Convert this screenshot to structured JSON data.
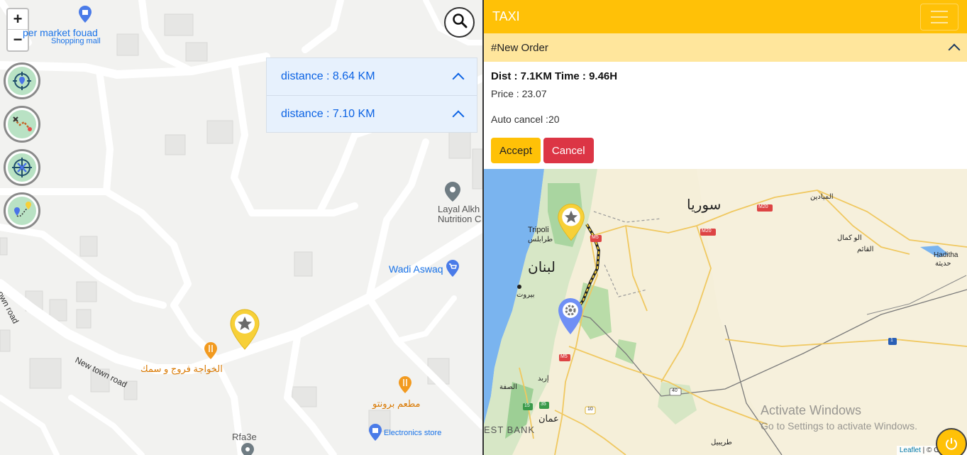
{
  "left_map": {
    "zoom_in": "+",
    "zoom_out": "−",
    "distances": [
      {
        "label": "distance : 8.64 KM"
      },
      {
        "label": "distance : 7.10 KM"
      }
    ],
    "pois": {
      "supermarket": "per market fouad",
      "supermarket_sub": "Shopping mall",
      "layal_1": "Layal Alkh",
      "layal_2": "Nutrition C",
      "wadi": "Wadi Aswaq",
      "khawaja": "الخواجة فروج و سمك",
      "brontu": "مطعم برونتو",
      "electronics": "Electronics store",
      "rfa3e": "Rfa3e"
    },
    "roads": {
      "town_road": "own road",
      "new_town_road": "New town road"
    },
    "icons": [
      "locate-icon",
      "route-icon",
      "target-icon",
      "path-icon",
      "search-icon"
    ]
  },
  "navbar": {
    "brand": "TAXI"
  },
  "order": {
    "header": "#New Order",
    "dist_time": "Dist : 7.1KM Time : 9.46H",
    "price": "Price : 23.07",
    "auto_cancel": "Auto cancel :20",
    "accept": "Accept",
    "cancel": "Cancel"
  },
  "right_map": {
    "labels": {
      "syria": "سوريا",
      "lebanon": "لبنان",
      "tripoli": "Tripoli",
      "tripoli_ar": "طرابلس",
      "beirut_ar": "بيروت",
      "amman_ar": "عمان",
      "irbid_ar": "إربد",
      "west_bank": "EST BANK",
      "tanf": "الو كمال",
      "qaim": "القائم",
      "mayadin": "الميادين",
      "haditha": "Haditha",
      "haditha_ar": "حديثة",
      "safa": "الصفة",
      "trabil": "طريبيل"
    },
    "road_signs": [
      "M20",
      "M20",
      "M5",
      "M5",
      "1",
      "40",
      "15",
      "35",
      "10"
    ],
    "watermark_title": "Activate Windows",
    "watermark_sub": "Go to Settings to activate Windows.",
    "attribution_leaflet": "Leaflet",
    "attribution_rest": "| © OpenStre"
  },
  "colors": {
    "accent": "#ffc107",
    "danger": "#dc3545",
    "link_blue": "#0c63e4",
    "marker_yellow": "#f7d038",
    "marker_blue": "#6f8ff5"
  }
}
